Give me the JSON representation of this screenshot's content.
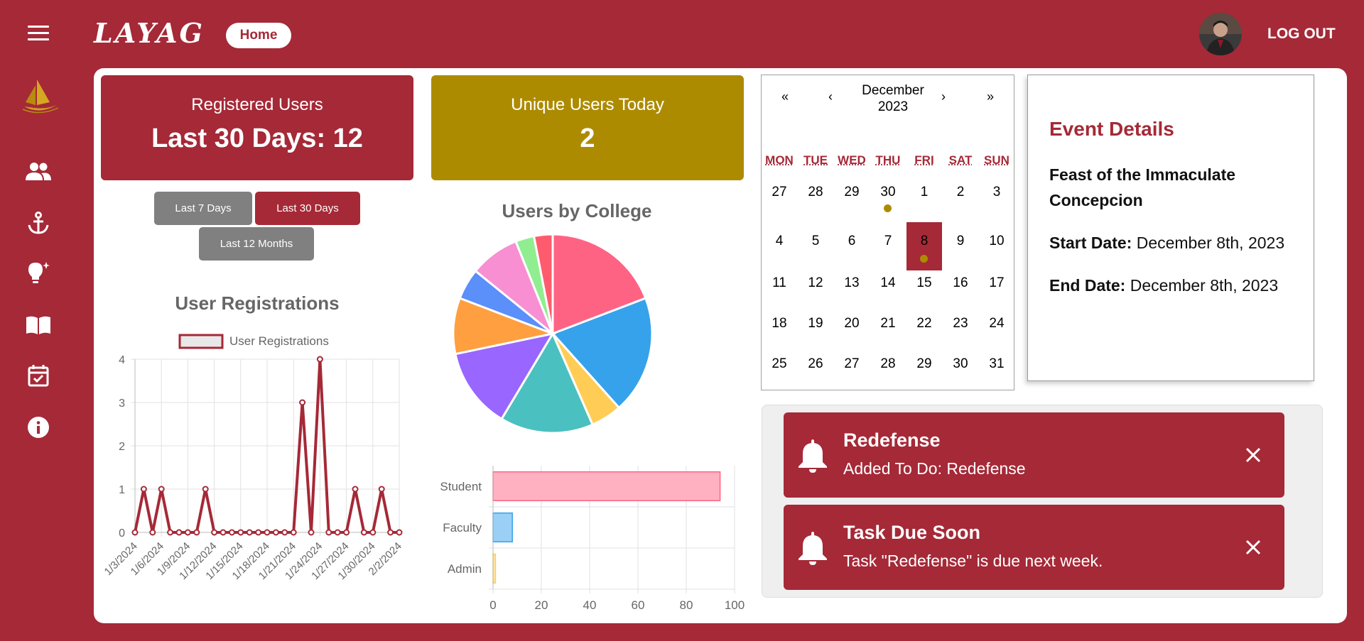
{
  "header": {
    "brand": "LAYAG",
    "home_label": "Home",
    "logout_label": "LOG OUT"
  },
  "sidebar": {
    "items": [
      {
        "name": "users",
        "icon": "group-icon"
      },
      {
        "name": "anchor",
        "icon": "anchor-icon"
      },
      {
        "name": "ideas",
        "icon": "lightbulb-icon"
      },
      {
        "name": "library",
        "icon": "book-icon"
      },
      {
        "name": "calendar",
        "icon": "calendar-check-icon"
      },
      {
        "name": "about",
        "icon": "info-icon"
      }
    ]
  },
  "stats": {
    "registered": {
      "label": "Registered Users",
      "value": "Last 30 Days: 12",
      "color": "#a52937"
    },
    "unique": {
      "label": "Unique Users Today",
      "value": "2",
      "color": "#ad8b00"
    }
  },
  "range_buttons": [
    {
      "label": "Last 7 Days",
      "active": false
    },
    {
      "label": "Last 30 Days",
      "active": true
    },
    {
      "label": "Last 12 Months",
      "active": false
    }
  ],
  "colors": {
    "brand": "#a52937",
    "gold": "#ad8b00",
    "gray_btn": "#808080"
  },
  "chart_data": [
    {
      "type": "line",
      "title": "User Registrations",
      "series": [
        {
          "name": "User Registrations",
          "color": "#a52937",
          "values": [
            0,
            1,
            0,
            1,
            0,
            0,
            0,
            0,
            1,
            0,
            0,
            0,
            0,
            0,
            0,
            0,
            0,
            0,
            0,
            3,
            0,
            4,
            0,
            0,
            0,
            1,
            0,
            0,
            1,
            0,
            0
          ]
        }
      ],
      "x": [
        "1/3/2024",
        "1/4/2024",
        "1/5/2024",
        "1/6/2024",
        "1/7/2024",
        "1/8/2024",
        "1/9/2024",
        "1/10/2024",
        "1/11/2024",
        "1/12/2024",
        "1/13/2024",
        "1/14/2024",
        "1/15/2024",
        "1/16/2024",
        "1/17/2024",
        "1/18/2024",
        "1/19/2024",
        "1/20/2024",
        "1/21/2024",
        "1/22/2024",
        "1/23/2024",
        "1/24/2024",
        "1/25/2024",
        "1/26/2024",
        "1/27/2024",
        "1/28/2024",
        "1/29/2024",
        "1/30/2024",
        "1/31/2024",
        "2/1/2024",
        "2/2/2024"
      ],
      "tick_labels": [
        "1/3/2024",
        "1/6/2024",
        "1/9/2024",
        "1/12/2024",
        "1/15/2024",
        "1/18/2024",
        "1/21/2024",
        "1/24/2024",
        "1/27/2024",
        "1/30/2024",
        "2/2/2024"
      ],
      "ylim": [
        0,
        4
      ],
      "yticks": [
        0,
        1,
        2,
        3,
        4
      ],
      "legend": "top",
      "grid": true
    },
    {
      "type": "pie",
      "title": "Users by College",
      "slices": [
        {
          "value": 19,
          "color": "#ff6384"
        },
        {
          "value": 19,
          "color": "#36a2eb"
        },
        {
          "value": 5,
          "color": "#ffcd56"
        },
        {
          "value": 15,
          "color": "#4bc0c0"
        },
        {
          "value": 13,
          "color": "#9966ff"
        },
        {
          "value": 9,
          "color": "#ff9f40"
        },
        {
          "value": 5,
          "color": "#5b8ff9"
        },
        {
          "value": 8,
          "color": "#f78fd2"
        },
        {
          "value": 3,
          "color": "#90ee90"
        },
        {
          "value": 3,
          "color": "#ff5b6e"
        }
      ]
    },
    {
      "type": "bar",
      "orientation": "horizontal",
      "categories": [
        "Student",
        "Faculty",
        "Admin"
      ],
      "values": [
        94,
        8,
        1
      ],
      "colors": [
        "#ffb1c1",
        "#9ad0f5",
        "#ffe6aa"
      ],
      "borders": [
        "#ff6384",
        "#36a2eb",
        "#ffcd56"
      ],
      "xlim": [
        0,
        100
      ],
      "xticks": [
        0,
        20,
        40,
        60,
        80,
        100
      ],
      "grid": true
    }
  ],
  "calendar": {
    "prev_year": "«",
    "prev_month": "‹",
    "next_month": "›",
    "next_year": "»",
    "month": "December",
    "year": "2023",
    "weekdays": [
      "MON",
      "TUE",
      "WED",
      "THU",
      "FRI",
      "SAT",
      "SUN"
    ],
    "weeks": [
      [
        "27",
        "28",
        "29",
        "30",
        "1",
        "2",
        "3"
      ],
      [
        "4",
        "5",
        "6",
        "7",
        "8",
        "9",
        "10"
      ],
      [
        "11",
        "12",
        "13",
        "14",
        "15",
        "16",
        "17"
      ],
      [
        "18",
        "19",
        "20",
        "21",
        "22",
        "23",
        "24"
      ],
      [
        "25",
        "26",
        "27",
        "28",
        "29",
        "30",
        "31"
      ]
    ],
    "selected": "8",
    "event_days": [
      "30",
      "8"
    ]
  },
  "event": {
    "heading": "Event Details",
    "name": "Feast of the Immaculate Concepcion",
    "start_label": "Start Date:",
    "start_value": "December 8th, 2023",
    "end_label": "End Date:",
    "end_value": "December 8th, 2023"
  },
  "notifications": [
    {
      "title": "Redefense",
      "message": "Added To Do: Redefense"
    },
    {
      "title": "Task Due Soon",
      "message": "Task \"Redefense\" is due next week."
    }
  ]
}
